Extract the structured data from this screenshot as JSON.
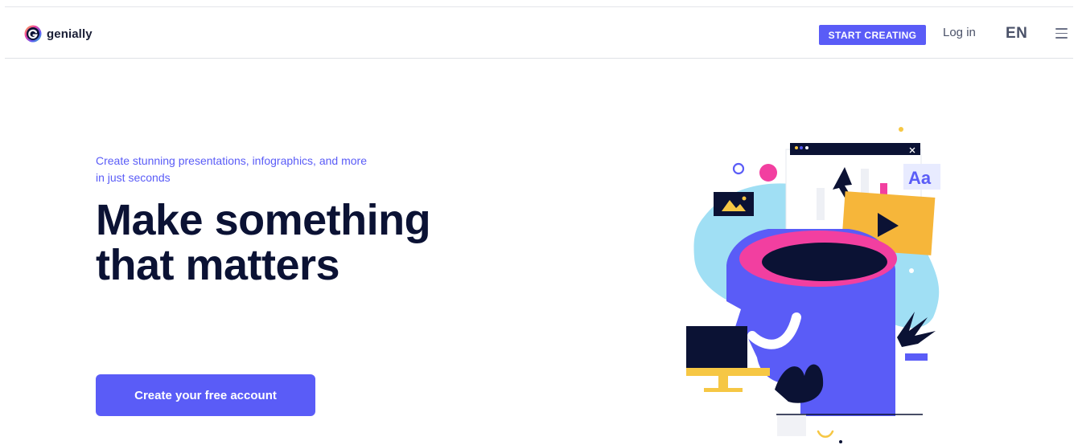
{
  "brand": {
    "name": "genially"
  },
  "nav": {
    "start_label": "START CREATING",
    "login_label": "Log in",
    "language": "EN"
  },
  "hero": {
    "subtitle": "Create stunning presentations, infographics, and more in just seconds",
    "title_line1": "Make something",
    "title_line2": "that matters",
    "cta_label": "Create your free account"
  },
  "illustration": {
    "badge_text": "Aa"
  },
  "colors": {
    "accent": "#5a5cf7",
    "title": "#0b1234",
    "pink": "#f23fa0",
    "yellow": "#f6c744",
    "light_blue": "#8fd9f2"
  }
}
